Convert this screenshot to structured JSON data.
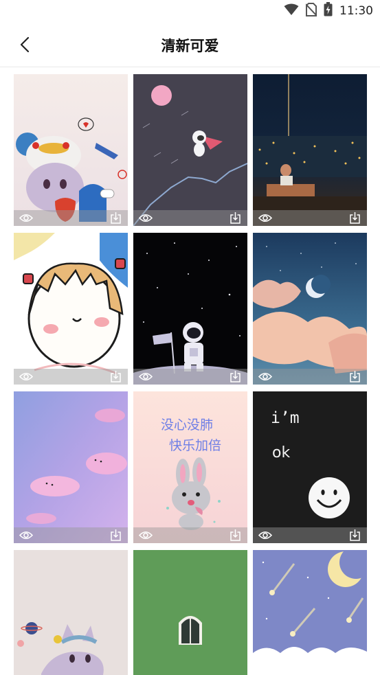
{
  "status_bar": {
    "time": "11:30",
    "icons": [
      "wifi-icon",
      "no-sim-icon",
      "battery-charging-icon"
    ]
  },
  "header": {
    "title": "清新可爱",
    "back_icon": "chevron-left-icon"
  },
  "wallpapers": [
    {
      "subject": "plush bunny toy with duck hat",
      "actions": [
        "eye-icon",
        "download-icon"
      ]
    },
    {
      "subject": "astronaut flying with pink moon",
      "actions": [
        "eye-icon",
        "download-icon"
      ]
    },
    {
      "subject": "night city rain with person",
      "actions": [
        "eye-icon",
        "download-icon"
      ]
    },
    {
      "subject": "cartoon girl face",
      "actions": [
        "eye-icon",
        "download-icon"
      ]
    },
    {
      "subject": "astronaut holding flag on moon",
      "actions": [
        "eye-icon",
        "download-icon"
      ]
    },
    {
      "subject": "crescent moon with pink clouds",
      "actions": [
        "eye-icon",
        "download-icon"
      ]
    },
    {
      "subject": "purple sky with cute clouds",
      "actions": [
        "eye-icon",
        "download-icon"
      ]
    },
    {
      "subject": "cartoon bunny",
      "actions": [
        "eye-icon",
        "download-icon"
      ],
      "text_line1": "没心没肺",
      "text_line2": "快乐加倍"
    },
    {
      "subject": "smiley face on black",
      "actions": [
        "eye-icon",
        "download-icon"
      ],
      "text_line1": "i’m",
      "text_line2": "ok"
    },
    {
      "subject": "plush cat toy with planet"
    },
    {
      "subject": "green wall with arched window"
    },
    {
      "subject": "crescent moon with shooting stars"
    }
  ],
  "colors": {
    "card_bar": "rgba(150,150,150,0.45)",
    "title_text": "#111111",
    "divider": "#e9e9e9"
  }
}
